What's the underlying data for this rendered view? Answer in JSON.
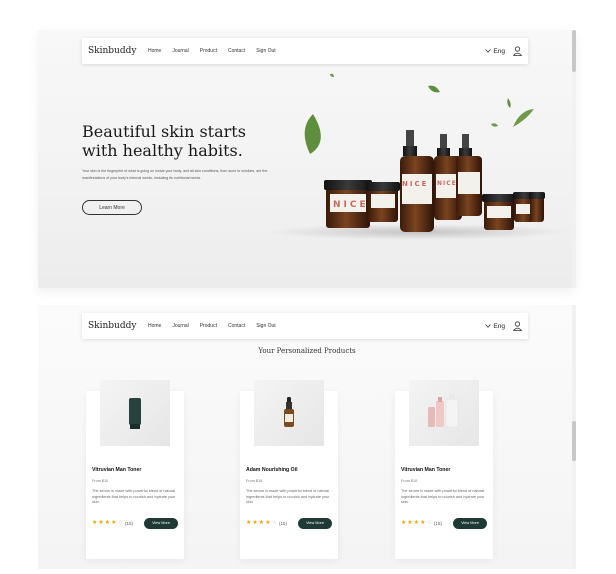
{
  "nav": {
    "logo": "Skinbuddy",
    "links": [
      "Home",
      "Journal",
      "Product",
      "Contact",
      "Sign Out"
    ],
    "language": "Eng",
    "language_icon": "chevron-down-icon",
    "user_icon": "user-icon"
  },
  "hero": {
    "title": "Beautiful skin starts with healthy habits.",
    "description": "Your skin is the fingerprint of what is going on inside your body, and all skin conditions, from acne to wrinkles, are the manifestations of your body's internal needs, including its nutritional needs.",
    "button_label": "Learn More",
    "product_brand": "NICE"
  },
  "products_section": {
    "title": "Your Personalized Products",
    "products": [
      {
        "name": "Vitruvian Man Toner",
        "price": "From $10",
        "description": "The serum is made with powerful blend of natural ingredients that helps to nourish and hydrate your skin.",
        "rating": 4,
        "reviews": "(15)",
        "button": "View More"
      },
      {
        "name": "Adam Nourishing Oil",
        "price": "From $18",
        "description": "The serum is made with powerful blend of natural ingredients that helps to nourish and hydrate your skin.",
        "rating": 4,
        "reviews": "(15)",
        "button": "View More"
      },
      {
        "name": "Vitruvian Man Toner",
        "price": "From $10",
        "description": "The serum is made with powerful blend of natural ingredients that helps to nourish and hydrate your skin.",
        "rating": 4,
        "reviews": "(15)",
        "button": "View More"
      }
    ]
  },
  "colors": {
    "accent_dark_green": "#1f3a34",
    "star": "#f0a500",
    "leaf_green": "#5f8f3e",
    "bottle_amber": "#6e3a1c"
  }
}
